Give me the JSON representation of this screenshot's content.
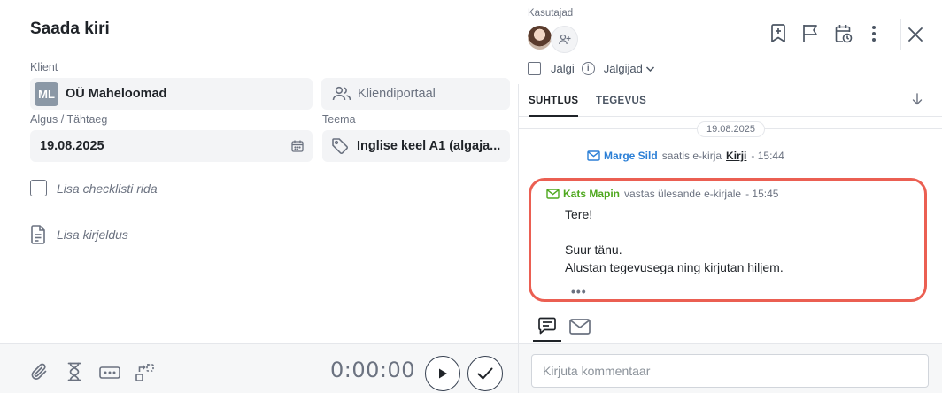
{
  "task": {
    "title": "Saada kiri",
    "client_label": "Klient",
    "client_initials": "ML",
    "client_name": "OÜ Maheloomad",
    "client_portal_label": "Kliendiportaal",
    "date_label": "Algus / Tähtaeg",
    "date_value": "19.08.2025",
    "topic_label": "Teema",
    "topic_value": "Inglise keel A1 (algaja...",
    "checklist_placeholder": "Lisa checklisti rida",
    "description_placeholder": "Lisa kirjeldus",
    "timer": "0:00:00"
  },
  "users": {
    "label": "Kasutajad"
  },
  "follow": {
    "follow_label": "Jälgi",
    "followers_label": "Jälgijad"
  },
  "tabs": [
    {
      "label": "SUHTLUS",
      "active": true
    },
    {
      "label": "TEGEVUS",
      "active": false
    }
  ],
  "feed": {
    "date": "19.08.2025",
    "event": {
      "sender": "Marge Sild",
      "action": "saatis e-kirja",
      "subject": "Kirji",
      "time": "- 15:44"
    },
    "message": {
      "sender": "Kats Mapin",
      "action": "vastas ülesande e-kirjale",
      "time": "- 15:45",
      "lines": [
        "Tere!",
        "",
        "Suur tänu.",
        "Alustan tegevusega ning kirjutan hiljem."
      ],
      "more": "•••"
    }
  },
  "comment": {
    "placeholder": "Kirjuta kommentaar"
  },
  "colors": {
    "highlight_border": "#eb5f52",
    "sender_blue": "#2b7fd6",
    "sender_green": "#4fa81f"
  }
}
